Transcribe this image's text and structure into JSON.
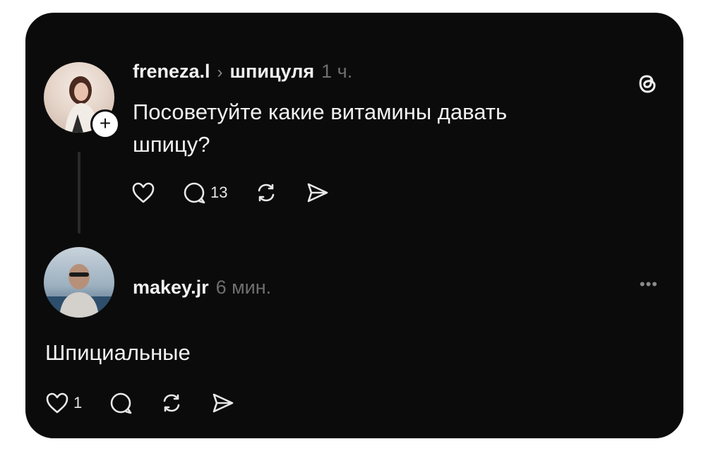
{
  "post": {
    "author": "freneza.l",
    "separator": "›",
    "topic": "шпицуля",
    "time": "1 ч.",
    "text": "Посоветуйте какие витамины давать шпицу?",
    "comment_count": "13",
    "add_icon": "+"
  },
  "reply": {
    "author": "makey.jr",
    "time": "6 мин.",
    "text": "Шпициальные",
    "like_count": "1",
    "more": "•••"
  },
  "icons": {
    "threads": "threads-logo-icon",
    "like": "heart-icon",
    "comment": "comment-icon",
    "repost": "repost-icon",
    "share": "send-icon"
  },
  "colors": {
    "card_bg": "#0b0b0b",
    "text": "#f2f2f2",
    "muted": "#6f6f6f"
  }
}
